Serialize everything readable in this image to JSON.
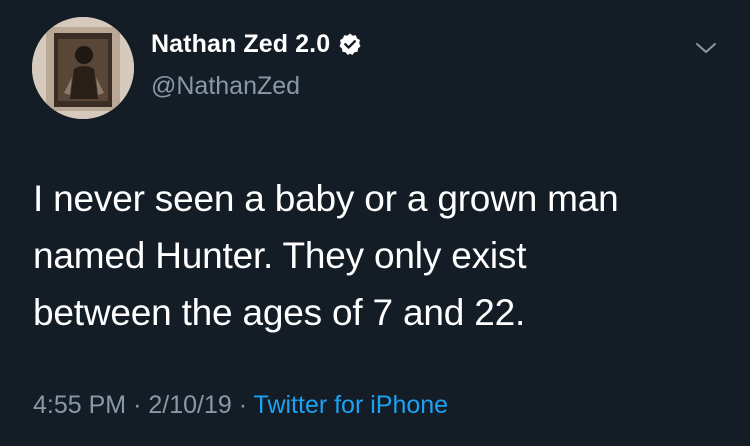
{
  "author": {
    "display_name": "Nathan Zed 2.0",
    "handle": "@NathanZed",
    "verified": true,
    "avatar_icon": "profile-photo"
  },
  "tweet": {
    "lines": [
      "I never seen a baby or a grown man",
      "named Hunter. They only exist",
      "between the ages of 7 and 22."
    ]
  },
  "meta": {
    "time": "4:55 PM",
    "separator": "·",
    "date": "2/10/19",
    "source": "Twitter for iPhone"
  },
  "icons": {
    "verified": "verified-badge-icon",
    "menu": "chevron-down-icon"
  },
  "colors": {
    "background": "#141d26",
    "secondary_text": "#8899a6",
    "link": "#1da1f2"
  }
}
